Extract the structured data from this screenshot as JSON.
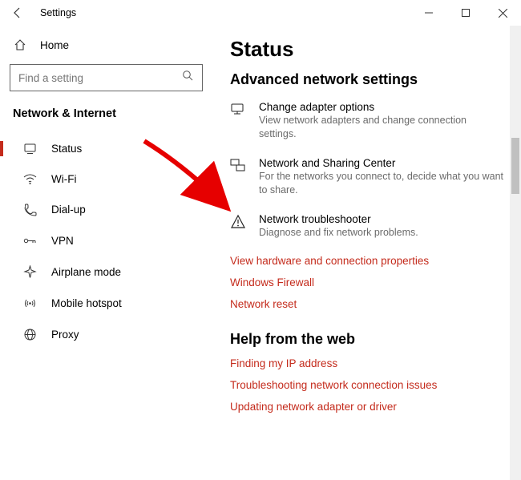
{
  "window": {
    "title": "Settings"
  },
  "sidebar": {
    "home": "Home",
    "search_placeholder": "Find a setting",
    "section": "Network & Internet",
    "items": [
      {
        "label": "Status"
      },
      {
        "label": "Wi-Fi"
      },
      {
        "label": "Dial-up"
      },
      {
        "label": "VPN"
      },
      {
        "label": "Airplane mode"
      },
      {
        "label": "Mobile hotspot"
      },
      {
        "label": "Proxy"
      }
    ]
  },
  "main": {
    "title": "Status",
    "subtitle": "Advanced network settings",
    "options": [
      {
        "label": "Change adapter options",
        "desc": "View network adapters and change connection settings."
      },
      {
        "label": "Network and Sharing Center",
        "desc": "For the networks you connect to, decide what you want to share."
      },
      {
        "label": "Network troubleshooter",
        "desc": "Diagnose and fix network problems."
      }
    ],
    "links": [
      "View hardware and connection properties",
      "Windows Firewall",
      "Network reset"
    ],
    "help_title": "Help from the web",
    "help_links": [
      "Finding my IP address",
      "Troubleshooting network connection issues",
      "Updating network adapter or driver"
    ]
  }
}
